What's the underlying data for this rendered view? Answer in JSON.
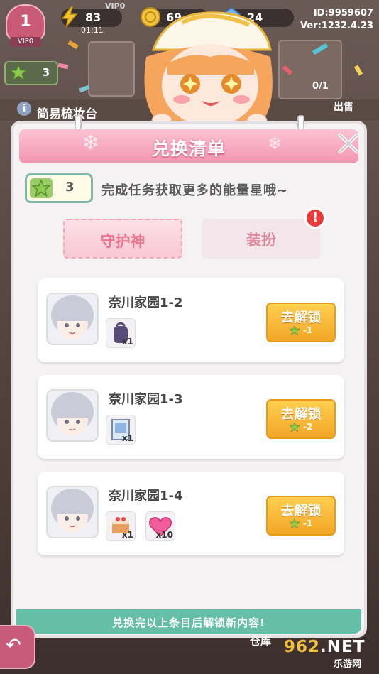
{
  "hud": {
    "level": "1",
    "vip_badge": "VIP0",
    "vip_tag": "VIP0",
    "energy": "83",
    "energy_timer": "01:11",
    "coins": "69",
    "gems": "24",
    "player_id": "ID:9959607",
    "version": "Ver:1232.4.23",
    "star_count_bg": "3",
    "shop_title": "简易梳妆台",
    "sell_label": "出售",
    "progress_count": "0/1",
    "storage_label": "仓库"
  },
  "modal": {
    "title": "兑换清单",
    "star_count": "3",
    "hint": "完成任务获取更多的能量星哦~",
    "tabs": [
      {
        "label": "守护神",
        "active": true
      },
      {
        "label": "装扮",
        "active": false,
        "alert": "!"
      }
    ],
    "entries": [
      {
        "name": "奈川家园1-2",
        "items": [
          {
            "icon": "backpack-icon",
            "qty": "x1"
          }
        ],
        "button": "去解锁",
        "cost": "-1"
      },
      {
        "name": "奈川家园1-3",
        "items": [
          {
            "icon": "painting-icon",
            "qty": "x1"
          }
        ],
        "button": "去解锁",
        "cost": "-2"
      },
      {
        "name": "奈川家园1-4",
        "items": [
          {
            "icon": "cake-icon",
            "qty": "x1"
          },
          {
            "icon": "heart-icon",
            "qty": "x10"
          }
        ],
        "button": "去解锁",
        "cost": "-1"
      }
    ],
    "footer": "兑换完以上条目后解锁新内容!"
  },
  "watermark": {
    "main_a": "9",
    "main_b": "62",
    "main_c": ".NET",
    "sub": "乐游网"
  },
  "colors": {
    "header_pink": "#f395b1",
    "unlock_orange": "#f2a628",
    "footer_teal": "#65bfa8",
    "star_green": "#9ccc6a",
    "alert_red": "#e93b3b"
  }
}
